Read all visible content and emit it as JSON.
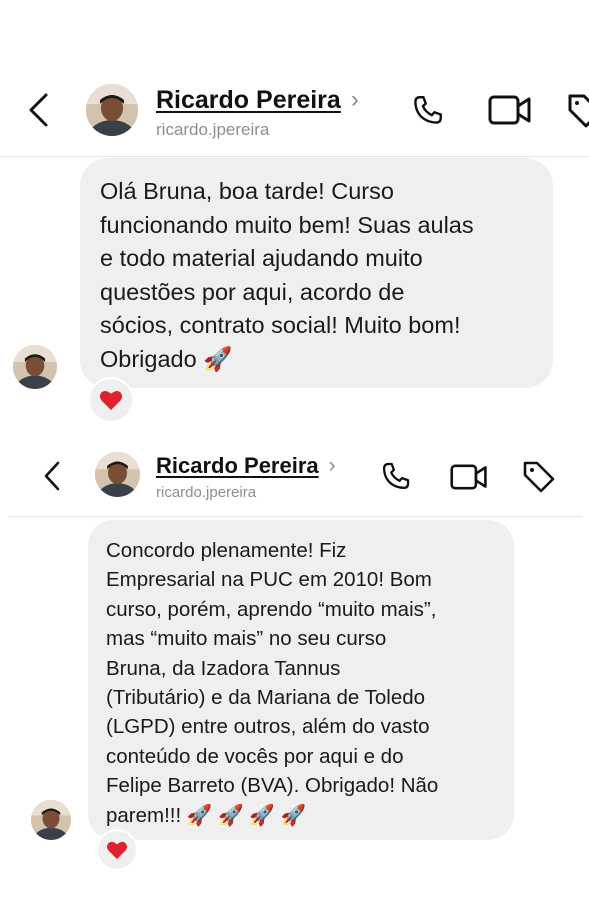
{
  "screens": [
    {
      "contact": {
        "name": "Ricardo Pereira",
        "handle": "ricardo.jpereira",
        "chevron": "›"
      },
      "message": {
        "text": "Olá Bruna, boa tarde! Curso\nfuncionando muito bem! Suas aulas\ne todo material ajudando muito\nquestões por aqui, acordo de\nsócios, contrato social! Muito bom!\nObrigado 🚀",
        "reaction": "❤️"
      }
    },
    {
      "contact": {
        "name": "Ricardo Pereira",
        "handle": "ricardo.jpereira",
        "chevron": "›"
      },
      "message": {
        "text": "Concordo plenamente! Fiz\nEmpresarial na PUC em 2010! Bom\ncurso, porém, aprendo “muito mais”,\nmas “muito mais” no seu curso\nBruna, da Izadora Tannus\n(Tributário) e  da Mariana de Toledo\n(LGPD) entre outros, além do vasto\nconteúdo de vocês por aqui e do\nFelipe Barreto (BVA). Obrigado! Não\nparem!!! 🚀 🚀 🚀 🚀",
        "reaction": "❤️"
      }
    }
  ],
  "icons": [
    "back-arrow-icon",
    "phone-icon",
    "video-camera-icon",
    "tag-icon",
    "heart-icon",
    "rocket-icon"
  ]
}
